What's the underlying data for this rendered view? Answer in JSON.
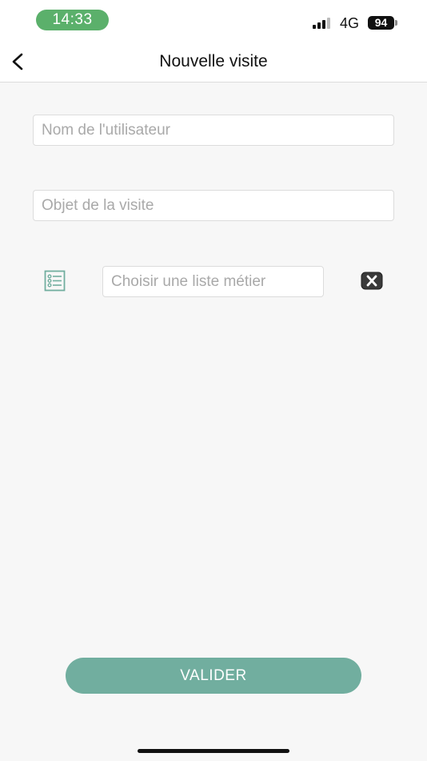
{
  "status_bar": {
    "time": "14:33",
    "network": "4G",
    "battery": "94",
    "signal_icon": "cellular-signal-icon",
    "battery_icon": "battery-icon"
  },
  "header": {
    "title": "Nouvelle visite",
    "back_icon": "chevron-left-icon"
  },
  "form": {
    "user_name": {
      "value": "",
      "placeholder": "Nom de l'utilisateur"
    },
    "visit_purpose": {
      "value": "",
      "placeholder": "Objet de la visite"
    },
    "business_list": {
      "value": "",
      "placeholder": "Choisir une liste métier",
      "list_icon": "checklist-icon",
      "clear_icon": "clear-x-icon"
    }
  },
  "actions": {
    "validate_label": "VALIDER"
  },
  "colors": {
    "accent": "#71ae9f",
    "status_pill": "#5bb06b",
    "background": "#f7f7f7"
  }
}
